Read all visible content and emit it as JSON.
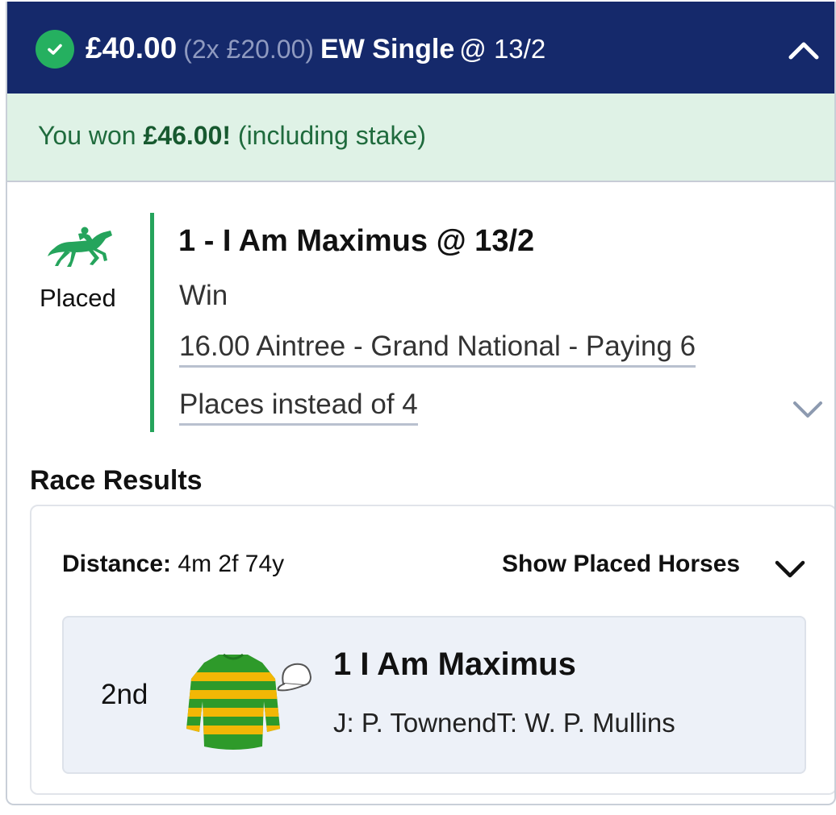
{
  "header": {
    "stake": "£40.00",
    "split": "(2x £20.00)",
    "bet_type": "EW Single",
    "odds": "@ 13/2",
    "icons": {
      "status": "check-circle-icon",
      "collapse": "chevron-up-icon"
    },
    "colors": {
      "background": "#15296b",
      "success": "#25b060"
    }
  },
  "win_banner": {
    "prefix": "You won",
    "amount": "£46.00!",
    "suffix": "(including stake)",
    "colors": {
      "background": "#dff2e6",
      "text": "#1f6b3d"
    }
  },
  "selection": {
    "status_icon": "horse-racing-icon",
    "status": "Placed",
    "title": "1 - I Am Maximus @ 13/2",
    "market": "Win",
    "event_line": "16.00 Aintree - Grand National - Paying 6",
    "places_line": "Places instead of 4",
    "expand_icon": "chevron-down-icon",
    "colors": {
      "accent": "#25a45c"
    }
  },
  "race_results": {
    "title": "Race Results",
    "distance_label": "Distance:",
    "distance_value": "4m 2f 74y",
    "show_placed_label": "Show Placed Horses",
    "runners": [
      {
        "position": "2nd",
        "name": "1 I Am Maximus",
        "jockey_trainer": "J: P. TownendT: W. P. Mullins",
        "silks_icon": "jockey-silks-icon",
        "silks_colors": {
          "primary": "#2e9a2a",
          "hoops": "#f2b705"
        }
      }
    ]
  }
}
